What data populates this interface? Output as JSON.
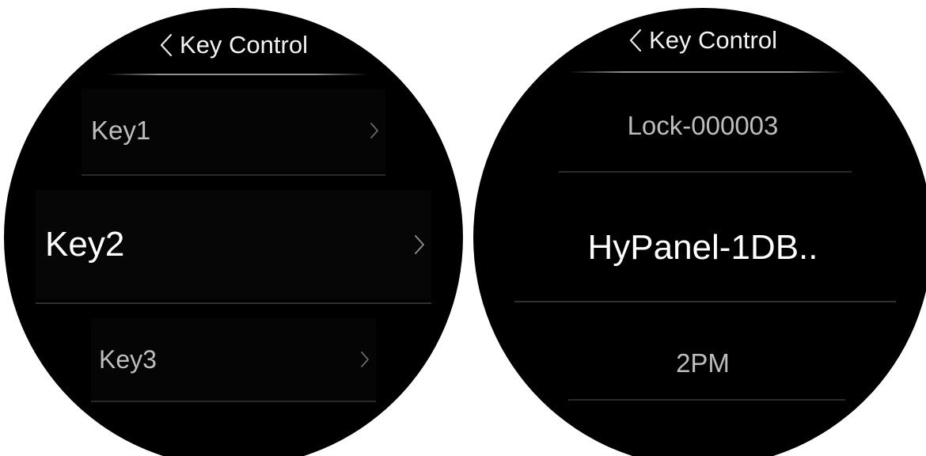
{
  "left_screen": {
    "header_title": "Key Control",
    "items": [
      {
        "label": "Key1"
      },
      {
        "label": "Key2"
      },
      {
        "label": "Key3"
      }
    ]
  },
  "right_screen": {
    "header_title": "Key Control",
    "items": [
      {
        "label": "Lock-000003"
      },
      {
        "label": "HyPanel-1DB.."
      },
      {
        "label": "2PM"
      }
    ]
  },
  "colors": {
    "screen_background": "#000000",
    "page_background": "#ffffff",
    "text_primary": "#ffffff",
    "text_secondary": "#bdbdbd",
    "divider": "#2a2a2a"
  },
  "icons": [
    "back-chevron-icon",
    "chevron-right-icon"
  ]
}
